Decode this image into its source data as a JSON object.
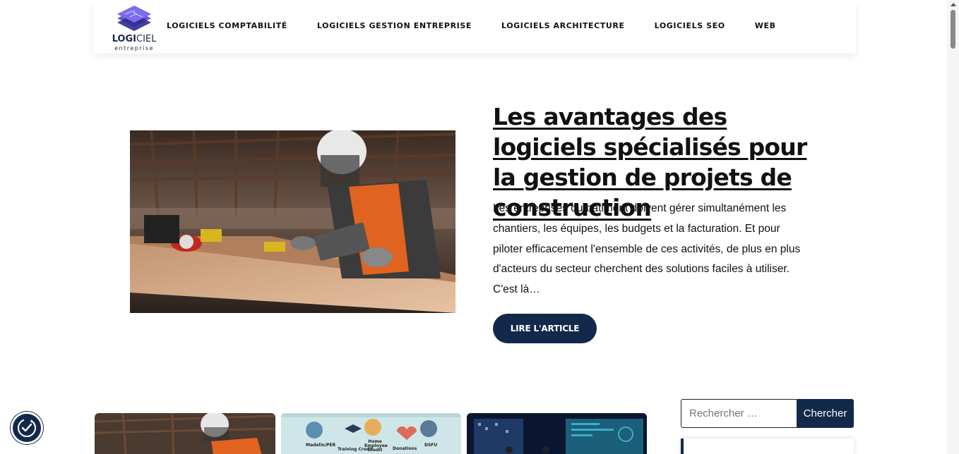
{
  "brand": {
    "name_bold": "LOGI",
    "name_light": "CIEL",
    "subtitle": "entreprise",
    "logo_icon": "layered-chip-logo"
  },
  "nav": {
    "items": [
      {
        "label": "LOGICIELS COMPTABILITÉ"
      },
      {
        "label": "LOGICIELS GESTION ENTREPRISE"
      },
      {
        "label": "LOGICIELS ARCHITECTURE"
      },
      {
        "label": "LOGICIELS SEO"
      },
      {
        "label": "WEB"
      }
    ]
  },
  "hero": {
    "title": "Les avantages des logiciels spécialisés pour la gestion de projets de construction",
    "excerpt": "Les entreprises du bâtiment doivent gérer simultanément les chantiers, les équipes, les budgets et la facturation. Et pour piloter efficacement l'ensemble de ces activités, de plus en plus d'acteurs du secteur cherchent des solutions faciles à utiliser. C'est là…",
    "button_label": "LIRE L'ARTICLE",
    "image_icon": "construction-worker-photo"
  },
  "cards": {
    "card2_labels": [
      "Madelin/PER",
      "Training Credit",
      "Home Employee Credit",
      "Donations",
      "DSFU"
    ]
  },
  "search": {
    "placeholder": "Rechercher …",
    "button_label": "Chercher"
  },
  "colors": {
    "accent": "#13294b",
    "text": "#111111",
    "background": "#ffffff"
  },
  "accessibility": {
    "icon": "accessibility-check-icon"
  }
}
